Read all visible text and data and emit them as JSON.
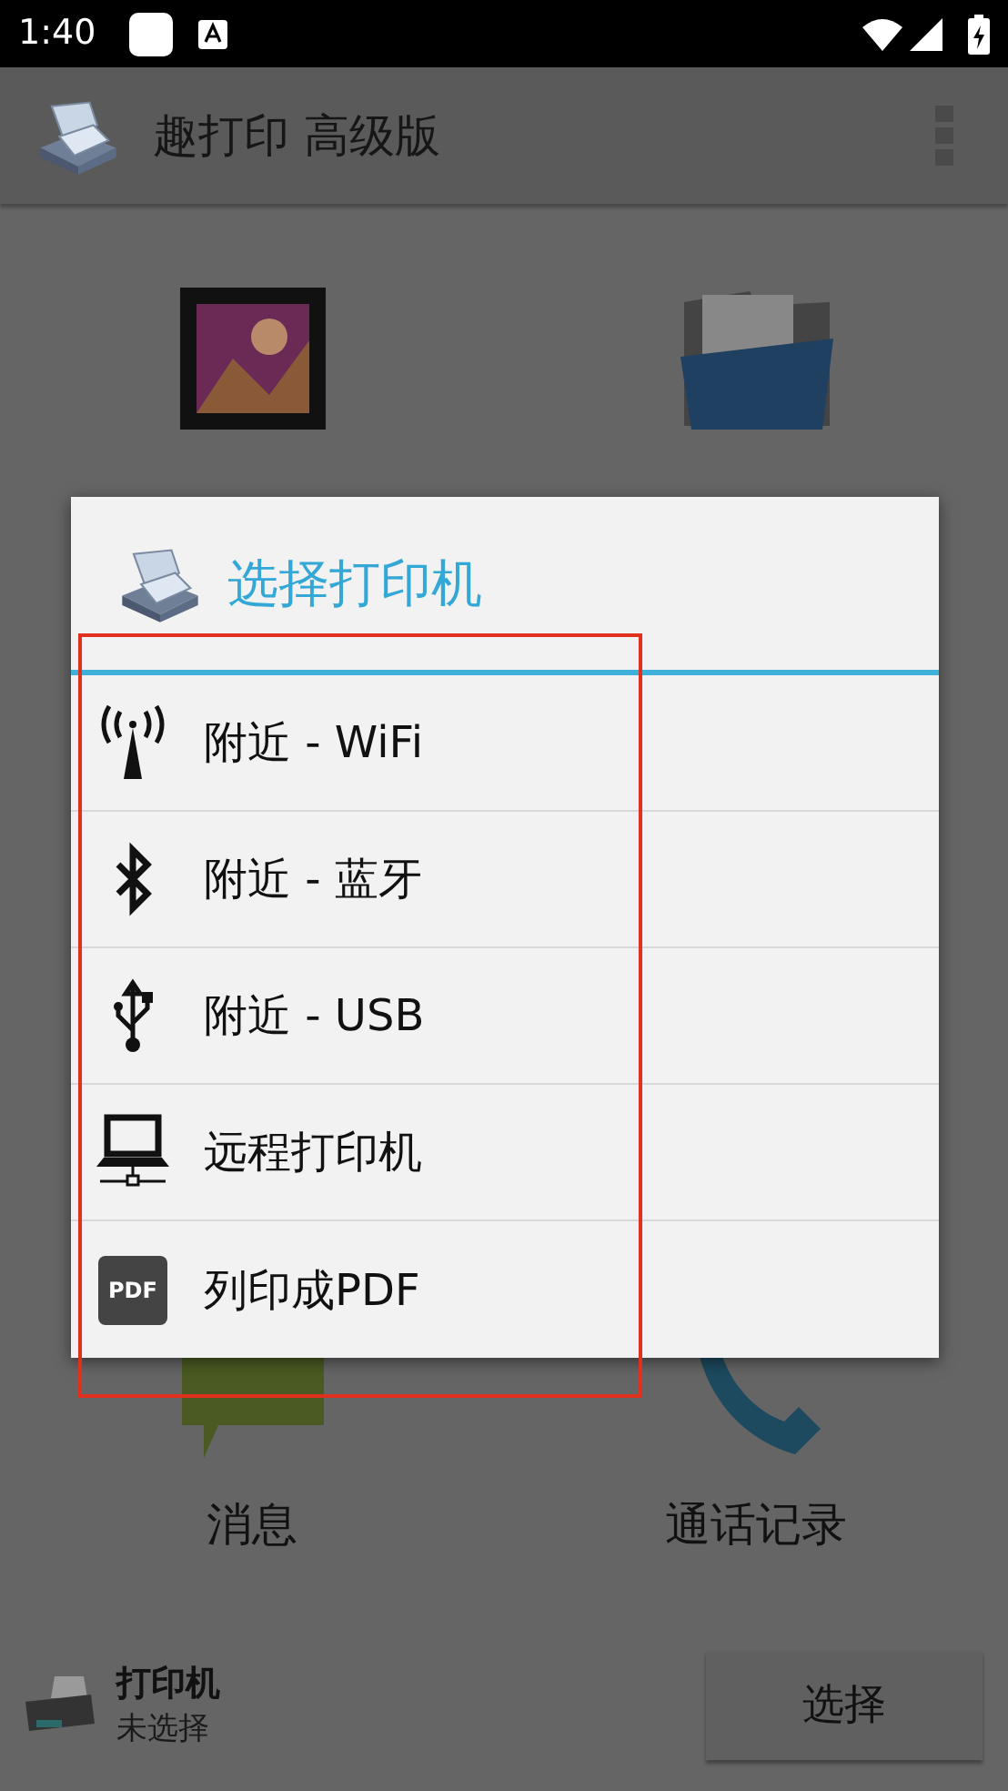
{
  "status_bar": {
    "time": "1:40"
  },
  "app_bar": {
    "title": "趣打印 高级版"
  },
  "home_items": [
    {
      "kind": "pictures"
    },
    {
      "kind": "documents"
    },
    {
      "kind": "messages",
      "label": "消息"
    },
    {
      "kind": "calls",
      "label": "通话记录"
    }
  ],
  "bottom_bar": {
    "title": "打印机",
    "subtitle": "未选择",
    "button": "选择"
  },
  "dialog": {
    "title": "选择打印机",
    "options": [
      {
        "kind": "wifi",
        "label": "附近 - WiFi"
      },
      {
        "kind": "bluetooth",
        "label": "附近 - 蓝牙"
      },
      {
        "kind": "usb",
        "label": "附近 - USB"
      },
      {
        "kind": "remote",
        "label": "远程打印机"
      },
      {
        "kind": "pdf",
        "label": "列印成PDF",
        "icon_text": "PDF"
      }
    ]
  }
}
